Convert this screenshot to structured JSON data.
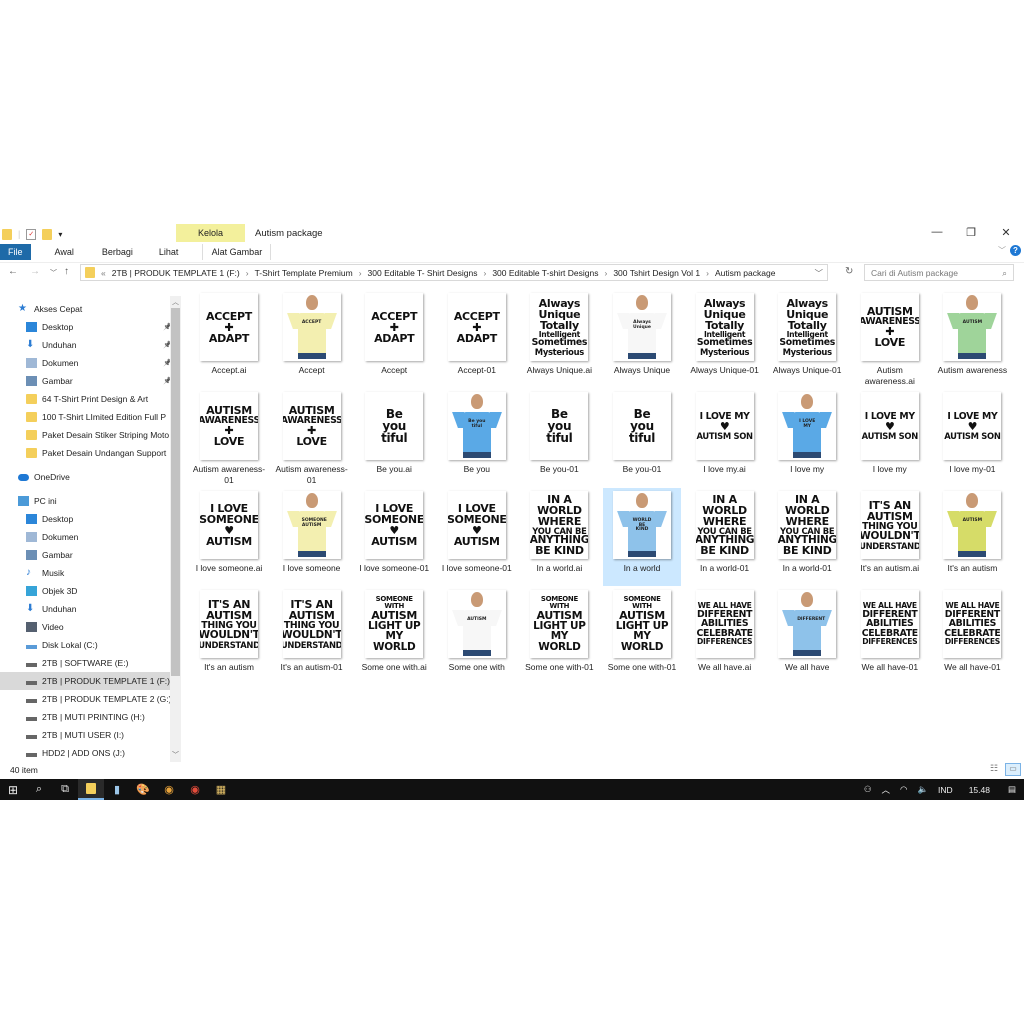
{
  "window": {
    "title": "Autism package",
    "context_tab": "Kelola",
    "context_tab_label": "Alat Gambar"
  },
  "ribbon": {
    "tabs": [
      "File",
      "Awal",
      "Berbagi",
      "Lihat"
    ]
  },
  "address": {
    "crumbs": [
      "2TB | PRODUK TEMPLATE 1 (F:)",
      "T-Shirt Template Premium",
      "300 Editable T- Shirt Designs",
      "300 Editable T-shirt Designs",
      "300 Tshirt Design Vol 1",
      "Autism package"
    ],
    "search_placeholder": "Cari di Autism package"
  },
  "sidebar": {
    "items": [
      {
        "label": "Akses Cepat",
        "icon": "star-icon",
        "color": "#2b7cd3",
        "indent": 0
      },
      {
        "label": "Desktop",
        "icon": "desktop-icon",
        "color": "#2b86d9",
        "indent": 1,
        "pinned": true
      },
      {
        "label": "Unduhan",
        "icon": "download-icon",
        "color": "#2b7cd3",
        "indent": 1,
        "pinned": true
      },
      {
        "label": "Dokumen",
        "icon": "document-icon",
        "color": "#9fb8d6",
        "indent": 1,
        "pinned": true
      },
      {
        "label": "Gambar",
        "icon": "pictures-icon",
        "color": "#6c8fb5",
        "indent": 1,
        "pinned": true
      },
      {
        "label": "64 T-Shirt Print Design & Art",
        "icon": "folder-icon",
        "color": "#f4cf5b",
        "indent": 1
      },
      {
        "label": "100 T-Shirt LImited Edition Full P",
        "icon": "folder-icon",
        "color": "#f4cf5b",
        "indent": 1
      },
      {
        "label": "Paket Desain Stiker Striping Moto",
        "icon": "folder-icon",
        "color": "#f4cf5b",
        "indent": 1
      },
      {
        "label": "Paket Desain Undangan Support",
        "icon": "folder-icon",
        "color": "#f4cf5b",
        "indent": 1
      },
      {
        "label": "OneDrive",
        "icon": "cloud-icon",
        "color": "#1e78d4",
        "indent": 0,
        "gap": true
      },
      {
        "label": "PC ini",
        "icon": "computer-icon",
        "color": "#4b9ad8",
        "indent": 0,
        "gap": true
      },
      {
        "label": "Desktop",
        "icon": "desktop-icon",
        "color": "#2b86d9",
        "indent": 1
      },
      {
        "label": "Dokumen",
        "icon": "document-icon",
        "color": "#9fb8d6",
        "indent": 1
      },
      {
        "label": "Gambar",
        "icon": "pictures-icon",
        "color": "#6c8fb5",
        "indent": 1
      },
      {
        "label": "Musik",
        "icon": "music-icon",
        "color": "#2b7cd3",
        "indent": 1
      },
      {
        "label": "Objek 3D",
        "icon": "cube-icon",
        "color": "#36a4d8",
        "indent": 1
      },
      {
        "label": "Unduhan",
        "icon": "download-icon",
        "color": "#2b7cd3",
        "indent": 1
      },
      {
        "label": "Video",
        "icon": "video-icon",
        "color": "#556070",
        "indent": 1
      },
      {
        "label": "Disk Lokal (C:)",
        "icon": "drive-icon",
        "color": "#5a9bd8",
        "indent": 1
      },
      {
        "label": "2TB | SOFTWARE (E:)",
        "icon": "drive-icon",
        "color": "#666",
        "indent": 1
      },
      {
        "label": "2TB | PRODUK TEMPLATE 1 (F:)",
        "icon": "drive-icon",
        "color": "#666",
        "indent": 1,
        "selected": true
      },
      {
        "label": "2TB | PRODUK TEMPLATE 2 (G:)",
        "icon": "drive-icon",
        "color": "#666",
        "indent": 1
      },
      {
        "label": "2TB | MUTI PRINTING (H:)",
        "icon": "drive-icon",
        "color": "#666",
        "indent": 1
      },
      {
        "label": "2TB | MUTI USER (I:)",
        "icon": "drive-icon",
        "color": "#666",
        "indent": 1
      },
      {
        "label": "HDD2 | ADD ONS (J:)",
        "icon": "drive-icon",
        "color": "#666",
        "indent": 1
      }
    ]
  },
  "files": [
    {
      "label": "Accept.ai",
      "kind": "design",
      "art": [
        "ACCEPT",
        "✚",
        "ADAPT"
      ]
    },
    {
      "label": "Accept",
      "kind": "shirt",
      "color": "#f3efb0",
      "art": [
        "ACCEPT"
      ]
    },
    {
      "label": "Accept",
      "kind": "design",
      "art": [
        "ACCEPT",
        "✚",
        "ADAPT"
      ]
    },
    {
      "label": "Accept-01",
      "kind": "design",
      "art": [
        "ACCEPT",
        "✚",
        "ADAPT"
      ]
    },
    {
      "label": "Always Unique.ai",
      "kind": "design",
      "art": [
        "Always",
        "Unique",
        "Totally",
        "Intelligent",
        "Sometimes",
        "Mysterious"
      ]
    },
    {
      "label": "Always Unique",
      "kind": "shirt",
      "color": "#f7f7f7",
      "art": [
        "Always Unique"
      ]
    },
    {
      "label": "Always Unique-01",
      "kind": "design",
      "art": [
        "Always",
        "Unique",
        "Totally",
        "Intelligent",
        "Sometimes",
        "Mysterious"
      ]
    },
    {
      "label": "Always Unique-01",
      "kind": "design",
      "art": [
        "Always",
        "Unique",
        "Totally",
        "Intelligent",
        "Sometimes",
        "Mysterious"
      ]
    },
    {
      "label": "Autism awareness.ai",
      "kind": "design",
      "art": [
        "AUTISM",
        "AWARENESS",
        "✚",
        "LOVE"
      ]
    },
    {
      "label": "Autism awareness",
      "kind": "shirt",
      "color": "#9fd49a",
      "art": [
        "AUTISM"
      ]
    },
    {
      "label": "Autism awareness-01",
      "kind": "design",
      "art": [
        "AUTISM",
        "AWARENESS",
        "✚",
        "LOVE"
      ]
    },
    {
      "label": "Autism awareness-01",
      "kind": "design",
      "art": [
        "AUTISM",
        "AWARENESS",
        "✚",
        "LOVE"
      ]
    },
    {
      "label": "Be you.ai",
      "kind": "design",
      "art": [
        "Be",
        "you",
        "tiful"
      ],
      "big": true
    },
    {
      "label": "Be you",
      "kind": "shirt",
      "color": "#5aa9e6",
      "art": [
        "Be you tiful"
      ]
    },
    {
      "label": "Be you-01",
      "kind": "design",
      "art": [
        "Be",
        "you",
        "tiful"
      ],
      "big": true
    },
    {
      "label": "Be you-01",
      "kind": "design",
      "art": [
        "Be",
        "you",
        "tiful"
      ],
      "big": true
    },
    {
      "label": "I love my.ai",
      "kind": "design",
      "art": [
        "I LOVE MY",
        "♥",
        "AUTISM SON"
      ]
    },
    {
      "label": "I love my",
      "kind": "shirt",
      "color": "#5aa9e6",
      "art": [
        "I LOVE MY"
      ]
    },
    {
      "label": "I love my",
      "kind": "design",
      "art": [
        "I LOVE MY",
        "♥",
        "AUTISM SON"
      ]
    },
    {
      "label": "I love my-01",
      "kind": "design",
      "art": [
        "I LOVE MY",
        "♥",
        "AUTISM SON"
      ]
    },
    {
      "label": "I love someone.ai",
      "kind": "design",
      "art": [
        "I LOVE",
        "SOMEONE",
        "♥",
        "AUTISM"
      ]
    },
    {
      "label": "I love someone",
      "kind": "shirt",
      "color": "#f3efb0",
      "art": [
        "SOMEONE AUTISM"
      ]
    },
    {
      "label": "I love someone-01",
      "kind": "design",
      "art": [
        "I LOVE",
        "SOMEONE",
        "♥",
        "AUTISM"
      ]
    },
    {
      "label": "I love someone-01",
      "kind": "design",
      "art": [
        "I LOVE",
        "SOMEONE",
        "♥",
        "AUTISM"
      ]
    },
    {
      "label": "In a world.ai",
      "kind": "design",
      "art": [
        "IN A",
        "WORLD",
        "WHERE",
        "YOU CAN BE",
        "ANYTHING",
        "BE KIND"
      ]
    },
    {
      "label": "In a world",
      "kind": "shirt",
      "color": "#8ec2ea",
      "art": [
        "WORLD BE KIND"
      ],
      "selected": true
    },
    {
      "label": "In a world-01",
      "kind": "design",
      "art": [
        "IN A",
        "WORLD",
        "WHERE",
        "YOU CAN BE",
        "ANYTHING",
        "BE KIND"
      ]
    },
    {
      "label": "In a world-01",
      "kind": "design",
      "art": [
        "IN A",
        "WORLD",
        "WHERE",
        "YOU CAN BE",
        "ANYTHING",
        "BE KIND"
      ]
    },
    {
      "label": "It's an autism.ai",
      "kind": "design",
      "art": [
        "IT'S AN",
        "AUTISM",
        "THING YOU",
        "WOULDN'T",
        "UNDERSTAND"
      ]
    },
    {
      "label": "It's an autism",
      "kind": "shirt",
      "color": "#d6dc68",
      "art": [
        "AUTISM"
      ]
    },
    {
      "label": "It's an autism",
      "kind": "design",
      "art": [
        "IT'S AN",
        "AUTISM",
        "THING YOU",
        "WOULDN'T",
        "UNDERSTAND"
      ]
    },
    {
      "label": "It's an autism-01",
      "kind": "design",
      "art": [
        "IT'S AN",
        "AUTISM",
        "THING YOU",
        "WOULDN'T",
        "UNDERSTAND"
      ]
    },
    {
      "label": "Some one with.ai",
      "kind": "design",
      "art": [
        "SOMEONE WITH",
        "AUTISM",
        "LIGHT UP",
        "MY WORLD"
      ]
    },
    {
      "label": "Some one with",
      "kind": "shirt",
      "color": "#f7f7f7",
      "art": [
        "AUTISM"
      ]
    },
    {
      "label": "Some one with-01",
      "kind": "design",
      "art": [
        "SOMEONE WITH",
        "AUTISM",
        "LIGHT UP",
        "MY WORLD"
      ]
    },
    {
      "label": "Some one with-01",
      "kind": "design",
      "art": [
        "SOMEONE WITH",
        "AUTISM",
        "LIGHT UP",
        "MY WORLD"
      ]
    },
    {
      "label": "We all have.ai",
      "kind": "design",
      "art": [
        "WE ALL HAVE",
        "DIFFERENT",
        "ABILITIES",
        "CELEBRATE",
        "DIFFERENCES"
      ]
    },
    {
      "label": "We all have",
      "kind": "shirt",
      "color": "#8ec2ea",
      "art": [
        "DIFFERENT"
      ]
    },
    {
      "label": "We all have-01",
      "kind": "design",
      "art": [
        "WE ALL HAVE",
        "DIFFERENT",
        "ABILITIES",
        "CELEBRATE",
        "DIFFERENCES"
      ]
    },
    {
      "label": "We all have-01",
      "kind": "design",
      "art": [
        "WE ALL HAVE",
        "DIFFERENT",
        "ABILITIES",
        "CELEBRATE",
        "DIFFERENCES"
      ]
    }
  ],
  "status": {
    "count": "40 item"
  },
  "taskbar": {
    "language": "IND",
    "time": "15.48"
  }
}
